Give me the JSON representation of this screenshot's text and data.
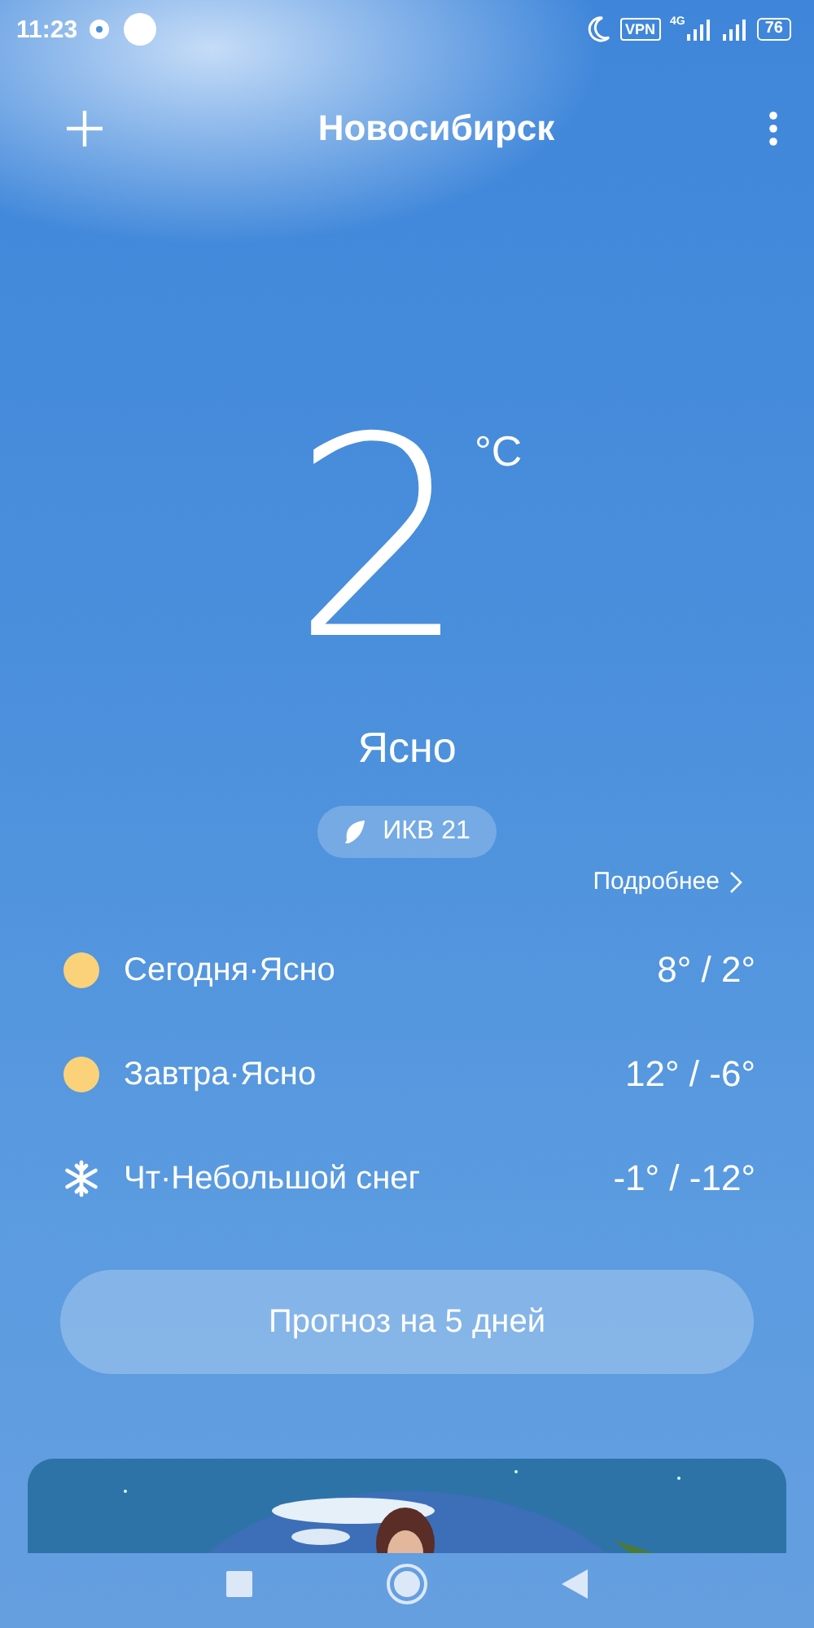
{
  "status_bar": {
    "time": "11:23",
    "vpn": "VPN",
    "network": "4G",
    "battery": "76"
  },
  "header": {
    "city": "Новосибирск"
  },
  "current": {
    "temperature": "2",
    "unit": "°C",
    "condition": "Ясно",
    "aqi": "ИКВ 21",
    "details_link": "Подробнее"
  },
  "forecast": [
    {
      "kind": "sun",
      "label": "Сегодня·Ясно",
      "temps": "8° / 2°"
    },
    {
      "kind": "sun",
      "label": "Завтра·Ясно",
      "temps": "12° / -6°"
    },
    {
      "kind": "snow",
      "label": "Чт·Небольшой снег",
      "temps": "-1° / -12°"
    }
  ],
  "forecast_button": "Прогноз на 5 дней"
}
